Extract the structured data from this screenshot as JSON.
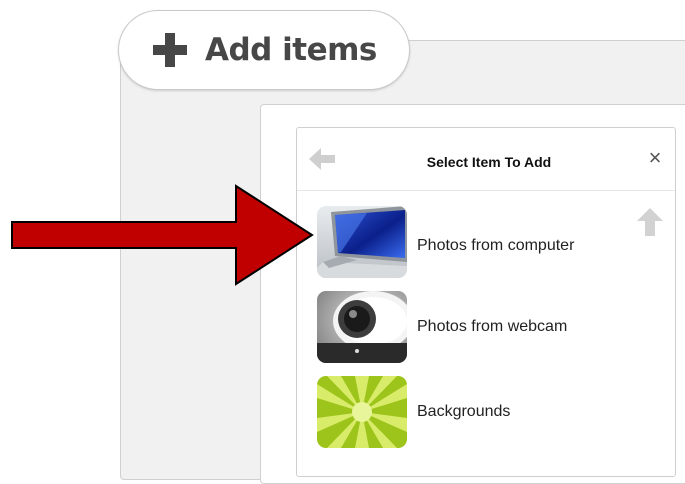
{
  "add_tab": {
    "label": "Add items",
    "icon": "plus-icon"
  },
  "dialog": {
    "title": "Select Item To Add",
    "back_icon": "back-arrow-icon",
    "close_icon": "close-icon",
    "close_glyph": "×",
    "scroll_up_icon": "up-arrow-icon",
    "items": [
      {
        "label": "Photos from computer",
        "icon": "computer-monitor-icon"
      },
      {
        "label": "Photos from webcam",
        "icon": "webcam-icon"
      },
      {
        "label": "Backgrounds",
        "icon": "green-sunburst-icon"
      }
    ]
  },
  "annotation": {
    "pointer_icon": "red-arrow-icon",
    "color": "#c00000"
  },
  "colors": {
    "tab_text": "#474747",
    "panel_bg": "#f1f1f1",
    "icon_gray": "#c8c8c8",
    "background_green": "#9cc41a"
  }
}
